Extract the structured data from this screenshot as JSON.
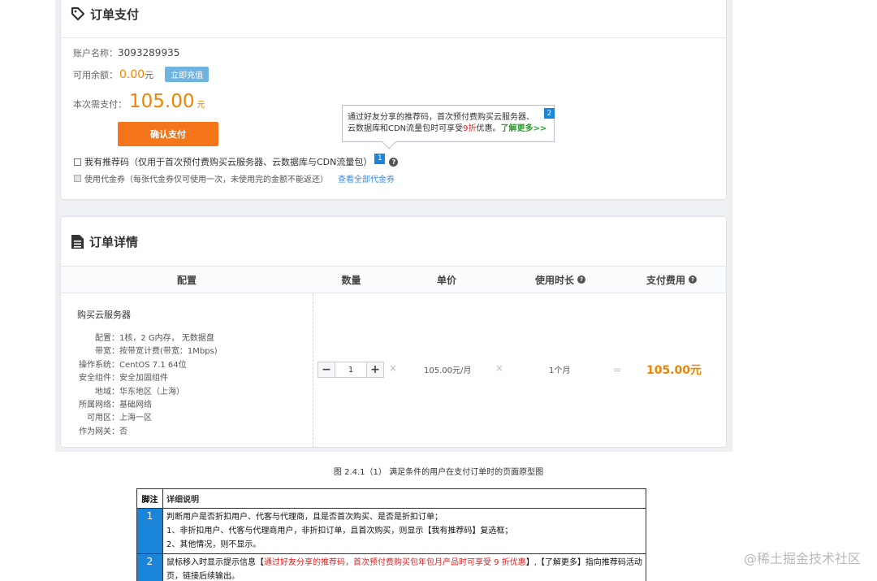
{
  "payment": {
    "title": "订单支付",
    "account_label": "账户名称：",
    "account_value": "3093289935",
    "balance_label": "可用余额：",
    "balance_value": "0.00",
    "balance_unit": "元",
    "recharge_label": "立即充值",
    "need_label": "本次需支付：",
    "need_value": "105.00",
    "need_unit": "元",
    "confirm_label": "确认支付",
    "referral_label": "我有推荐码（仅用于首次预付费购买云服务器、云数据库与CDN流量包）",
    "referral_badge": "1",
    "help_glyph": "?",
    "coupon_label": "使用代金券（每张代金券仅可使用一次，未使用完的金额不能返还）",
    "coupon_link": "查看全部代金券",
    "tooltip": {
      "line1": "通过好友分享的推荐码，首次预付费购买云服务器、",
      "line2_a": "云数据库和CDN流量包时可享受",
      "line2_red": "9折",
      "line2_b": "优惠。",
      "line2_link": "了解更多>>",
      "badge": "2"
    }
  },
  "details": {
    "title": "订单详情",
    "headers": [
      "配置",
      "数量",
      "单价",
      "使用时长",
      "支付费用"
    ],
    "product_title": "购买云服务器",
    "config_rows": [
      {
        "label": "配置：",
        "value": "1核，2 G内存， 无数据盘"
      },
      {
        "label": "带宽：",
        "value": "按带宽计费(带宽：1Mbps)"
      },
      {
        "label": "操作系统：",
        "value": "CentOS 7.1 64位"
      },
      {
        "label": "安全组件：",
        "value": "安全加固组件"
      },
      {
        "label": "地域：",
        "value": "华东地区（上海）"
      },
      {
        "label": "所属网络：",
        "value": "基础网络"
      },
      {
        "label": "可用区：",
        "value": "上海一区"
      },
      {
        "label": "作为网关：",
        "value": "否"
      }
    ],
    "minus": "−",
    "quantity": "1",
    "plus": "+",
    "times": "×",
    "equals": "=",
    "unit_price": "105.00元/月",
    "duration": "1个月",
    "total": "105.00元"
  },
  "caption": "图 2.4.1（1） 满足条件的用户在支付订单时的页面原型图",
  "notes": {
    "col_no": "脚注",
    "col_desc": "详细说明",
    "rows": [
      {
        "no": "1",
        "lines": [
          "判断用户是否折扣用户、代客与代理商，且是否首次购买、是否是折扣订单；",
          "1、非折扣用户、代客与代理商用户，非折扣订单，且首次购买，则显示【我有推荐码】复选框；",
          "2、其他情况，则不显示。"
        ]
      },
      {
        "no": "2",
        "pre": "鼠标移入时显示提示信息【",
        "red": "通过好友分享的推荐码，首次预付费购买包年包月产品时可享受 9 折优惠",
        "post": "】,【了解更多】指向推荐码活动页，链接后续输出。"
      }
    ]
  },
  "watermark": "@稀土掘金技术社区",
  "colors": {
    "accent": "#f08300",
    "button": "#f5761a",
    "badge": "#1b86d9",
    "link": "#3b8ad9",
    "danger": "#e02020"
  }
}
